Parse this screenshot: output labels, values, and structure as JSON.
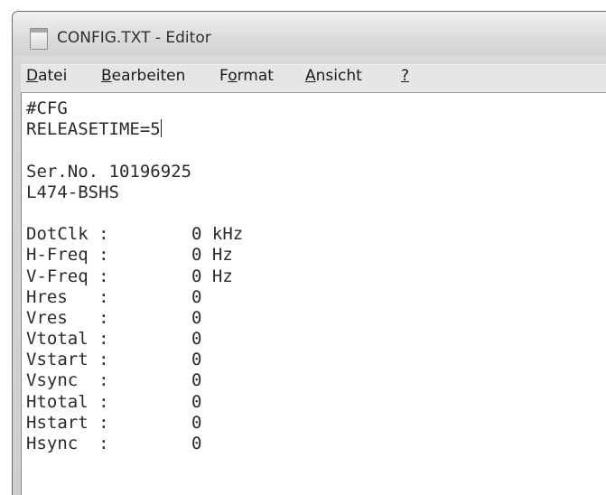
{
  "window": {
    "title": "CONFIG.TXT - Editor"
  },
  "menu": {
    "items": [
      {
        "id": "datei",
        "accel": "D",
        "rest": "atei"
      },
      {
        "id": "bearbeiten",
        "accel": "B",
        "rest": "earbeiten"
      },
      {
        "id": "format",
        "pre": "F",
        "accel": "o",
        "rest": "rmat"
      },
      {
        "id": "ansicht",
        "accel": "A",
        "rest": "nsicht"
      },
      {
        "id": "help",
        "accel": "?",
        "rest": ""
      }
    ]
  },
  "document": {
    "lines": [
      "#CFG",
      "RELEASETIME=5",
      "",
      "Ser.No. 10196925",
      "L474-BSHS",
      "",
      "DotClk :        0 kHz",
      "H-Freq :        0 Hz",
      "V-Freq :        0 Hz",
      "Hres   :        0",
      "Vres   :        0",
      "Vtotal :        0",
      "Vstart :        0",
      "Vsync  :        0",
      "Htotal :        0",
      "Hstart :        0",
      "Hsync  :        0"
    ],
    "caret_line": 1
  },
  "colors": {
    "window_frame": "#d6d6d6",
    "editor_bg": "#ffffff",
    "text": "#2a2a2a"
  }
}
